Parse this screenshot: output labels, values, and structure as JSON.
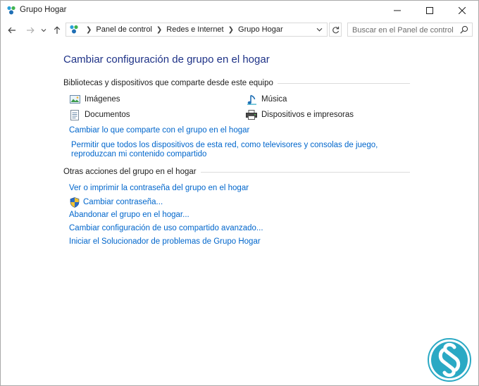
{
  "window": {
    "title": "Grupo Hogar",
    "icon": "homegroup-icon"
  },
  "nav": {
    "breadcrumbs": [
      "Panel de control",
      "Redes e Internet",
      "Grupo Hogar"
    ],
    "search_placeholder": "Buscar en el Panel de control"
  },
  "main": {
    "heading": "Cambiar configuración de grupo en el hogar",
    "shared": {
      "title": "Bibliotecas y dispositivos que comparte desde este equipo",
      "items": [
        {
          "label": "Imágenes",
          "icon": "pictures-icon"
        },
        {
          "label": "Música",
          "icon": "music-icon"
        },
        {
          "label": "Documentos",
          "icon": "documents-icon"
        },
        {
          "label": "Dispositivos e impresoras",
          "icon": "printer-icon"
        }
      ],
      "change_link": "Cambiar lo que comparte con el grupo en el hogar",
      "allow_link": "Permitir que todos los dispositivos de esta red, como televisores y consolas de juego, reproduzcan mi contenido compartido"
    },
    "other": {
      "title": "Otras acciones del grupo en el hogar",
      "links": [
        "Ver o imprimir la contraseña del grupo en el hogar",
        "Cambiar contraseña...",
        "Abandonar el grupo en el hogar...",
        "Cambiar configuración de uso compartido avanzado...",
        "Iniciar el Solucionador de problemas de Grupo Hogar"
      ]
    }
  },
  "colors": {
    "link": "#0066cc",
    "heading": "#1e3287",
    "logo": "#2aa9c4"
  }
}
